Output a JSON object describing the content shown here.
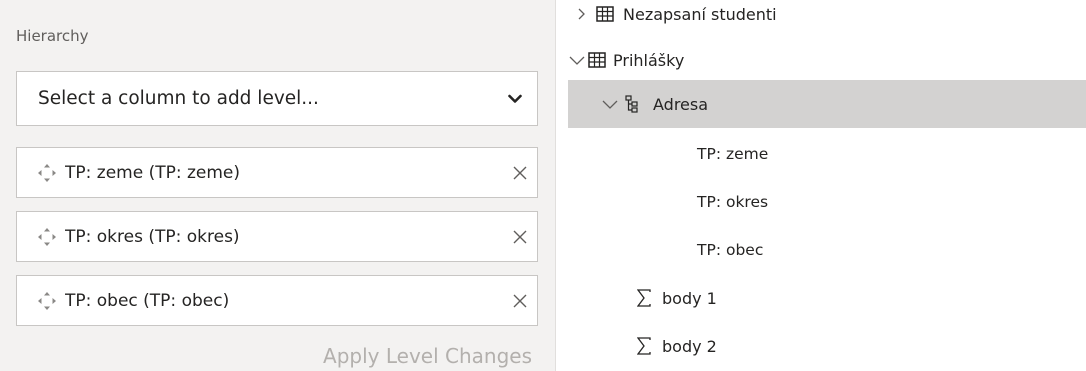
{
  "hierarchy_panel": {
    "section_label": "Hierarchy",
    "select": {
      "placeholder": "Select a column to add level...",
      "chevron_icon": "chevron-down-icon"
    },
    "levels": [
      {
        "label": "TP: zeme (TP: zeme)",
        "drag_icon": "move-icon",
        "remove_icon": "close-icon"
      },
      {
        "label": "TP: okres (TP: okres)",
        "drag_icon": "move-icon",
        "remove_icon": "close-icon"
      },
      {
        "label": "TP: obec (TP: obec)",
        "drag_icon": "move-icon",
        "remove_icon": "close-icon"
      }
    ],
    "apply_button": {
      "label": "Apply Level Changes",
      "state": "disabled"
    }
  },
  "fields_tree": {
    "items": [
      {
        "label": "Nezapsaní studenti",
        "icon": "table-icon",
        "expander": "chevron-right-icon"
      },
      {
        "label": "Prihlášky",
        "icon": "table-icon",
        "expander": "chevron-down-icon"
      },
      {
        "label": "Adresa",
        "icon": "hierarchy-icon",
        "expander": "chevron-down-icon",
        "selected": true
      },
      {
        "label": "TP: zeme"
      },
      {
        "label": "TP: okres"
      },
      {
        "label": "TP: obec"
      },
      {
        "label": "body 1",
        "icon": "sigma-icon"
      },
      {
        "label": "body 2",
        "icon": "sigma-icon"
      }
    ]
  },
  "colors": {
    "panel_background": "#f3f2f1",
    "selected_row": "#d3d2d1",
    "border": "#c8c6c4",
    "disabled_text": "#b3b0ad"
  }
}
